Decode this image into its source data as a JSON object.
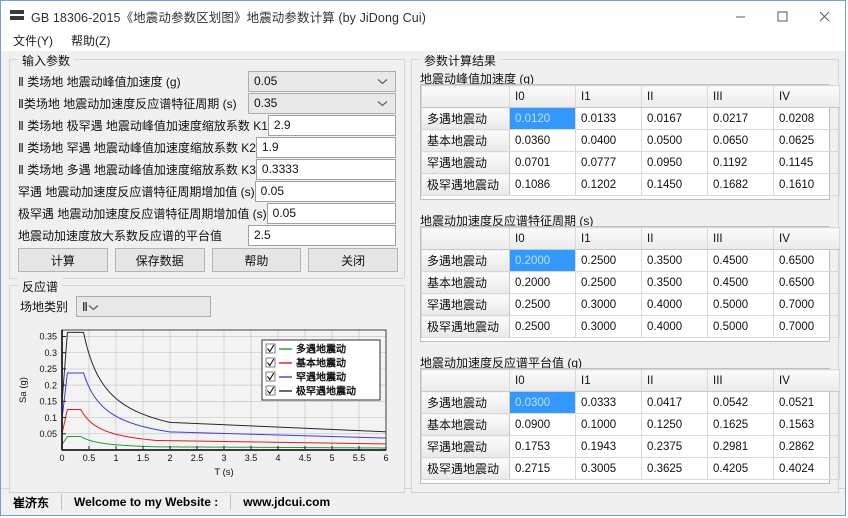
{
  "window": {
    "title": "GB 18306-2015《地震动参数区划图》地震动参数计算 (by JiDong Cui)",
    "icon": "app-icon",
    "minimize": "minimize-icon",
    "maximize": "maximize-icon",
    "close": "close-icon"
  },
  "menu": {
    "items": [
      {
        "label": "文件(Y)"
      },
      {
        "label": "帮助(Z)"
      }
    ]
  },
  "input_group": {
    "title": "输入参数",
    "rows": [
      {
        "label": "Ⅱ 类场地 地震动峰值加速度 (g)",
        "value": "0.05",
        "type": "combo"
      },
      {
        "label": "Ⅱ类场地 地震动加速度反应谱特征周期 (s)",
        "value": "0.35",
        "type": "combo"
      },
      {
        "label": "Ⅱ 类场地 极罕遇 地震动峰值加速度缩放系数 K1",
        "value": "2.9",
        "type": "text"
      },
      {
        "label": "Ⅱ 类场地 罕遇 地震动峰值加速度缩放系数 K2",
        "value": "1.9",
        "type": "text"
      },
      {
        "label": "Ⅱ 类场地 多遇 地震动峰值加速度缩放系数 K3",
        "value": "0.3333",
        "type": "text"
      },
      {
        "label": "罕遇 地震动加速度反应谱特征周期增加值 (s)",
        "value": "0.05",
        "type": "text"
      },
      {
        "label": "极罕遇 地震动加速度反应谱特征周期增加值 (s)",
        "value": "0.05",
        "type": "text"
      },
      {
        "label": "地震动加速度放大系数反应谱的平台值",
        "value": "2.5",
        "type": "text"
      }
    ],
    "buttons": [
      {
        "label": "计算"
      },
      {
        "label": "保存数据"
      },
      {
        "label": "帮助"
      },
      {
        "label": "关闭"
      }
    ]
  },
  "spectrum_group": {
    "title": "反应谱",
    "site_label": "场地类别",
    "site_value": "Ⅱ"
  },
  "result_group": {
    "title": "参数计算结果",
    "tables": [
      {
        "caption": "地震动峰值加速度 (g)",
        "columns": [
          "",
          "I0",
          "I1",
          "II",
          "III",
          "IV"
        ],
        "rows": [
          {
            "label": "多遇地震动",
            "values": [
              "0.0120",
              "0.0133",
              "0.0167",
              "0.0217",
              "0.0208"
            ],
            "selected": 0
          },
          {
            "label": "基本地震动",
            "values": [
              "0.0360",
              "0.0400",
              "0.0500",
              "0.0650",
              "0.0625"
            ]
          },
          {
            "label": "罕遇地震动",
            "values": [
              "0.0701",
              "0.0777",
              "0.0950",
              "0.1192",
              "0.1145"
            ]
          },
          {
            "label": "极罕遇地震动",
            "values": [
              "0.1086",
              "0.1202",
              "0.1450",
              "0.1682",
              "0.1610"
            ]
          }
        ]
      },
      {
        "caption": "地震动加速度反应谱特征周期 (s)",
        "columns": [
          "",
          "I0",
          "I1",
          "II",
          "III",
          "IV"
        ],
        "rows": [
          {
            "label": "多遇地震动",
            "values": [
              "0.2000",
              "0.2500",
              "0.3500",
              "0.4500",
              "0.6500"
            ],
            "selected": 0
          },
          {
            "label": "基本地震动",
            "values": [
              "0.2000",
              "0.2500",
              "0.3500",
              "0.4500",
              "0.6500"
            ]
          },
          {
            "label": "罕遇地震动",
            "values": [
              "0.2500",
              "0.3000",
              "0.4000",
              "0.5000",
              "0.7000"
            ]
          },
          {
            "label": "极罕遇地震动",
            "values": [
              "0.2500",
              "0.3000",
              "0.4000",
              "0.5000",
              "0.7000"
            ]
          }
        ]
      },
      {
        "caption": "地震动加速度反应谱平台值 (g)",
        "columns": [
          "",
          "I0",
          "I1",
          "II",
          "III",
          "IV"
        ],
        "rows": [
          {
            "label": "多遇地震动",
            "values": [
              "0.0300",
              "0.0333",
              "0.0417",
              "0.0542",
              "0.0521"
            ],
            "selected": 0
          },
          {
            "label": "基本地震动",
            "values": [
              "0.0900",
              "0.1000",
              "0.1250",
              "0.1625",
              "0.1563"
            ]
          },
          {
            "label": "罕遇地震动",
            "values": [
              "0.1753",
              "0.1943",
              "0.2375",
              "0.2981",
              "0.2862"
            ]
          },
          {
            "label": "极罕遇地震动",
            "values": [
              "0.2715",
              "0.3005",
              "0.3625",
              "0.4205",
              "0.4024"
            ]
          }
        ]
      }
    ]
  },
  "statusbar": {
    "author": "崔济东",
    "welcome": "Welcome to my Website :",
    "website": "www.jdcui.com"
  },
  "chart_data": {
    "type": "line",
    "title": "",
    "xlabel": "T (s)",
    "ylabel": "Sa (g)",
    "xlim": [
      0,
      6
    ],
    "ylim": [
      0,
      0.37
    ],
    "xticks": [
      0,
      0.5,
      1,
      1.5,
      2,
      2.5,
      3,
      3.5,
      4,
      4.5,
      5,
      5.5,
      6
    ],
    "xtick_labels": [
      "0",
      "0.5",
      "1",
      "1.5",
      "2",
      "2.5",
      "3",
      "3.5",
      "4",
      "4.5",
      "5",
      "5.5",
      "6"
    ],
    "yticks": [
      0.05,
      0.1,
      0.15,
      0.2,
      0.25,
      0.3,
      0.35
    ],
    "ytick_labels": [
      "0.05",
      "0.1",
      "0.15",
      "0.2",
      "0.25",
      "0.3",
      "0.35"
    ],
    "grid": true,
    "legend_position": "upper-right",
    "series": [
      {
        "name": "多遇地震动",
        "color": "#1f9e34",
        "checked": true,
        "plateau": 0.0417,
        "Tg": 0.35,
        "T0": 0.1,
        "a0": 0.0167,
        "points": [
          [
            0.0,
            0.0167
          ],
          [
            0.02,
            0.0217
          ],
          [
            0.05,
            0.0292
          ],
          [
            0.1,
            0.0417
          ],
          [
            0.2,
            0.0417
          ],
          [
            0.35,
            0.0417
          ],
          [
            0.5,
            0.0334
          ],
          [
            0.75,
            0.0253
          ],
          [
            1.0,
            0.0204
          ],
          [
            1.5,
            0.015
          ],
          [
            2.0,
            0.012
          ],
          [
            2.5,
            0.0101
          ],
          [
            3.0,
            0.008
          ],
          [
            3.5,
            0.0062
          ],
          [
            4.0,
            0.0045
          ],
          [
            4.5,
            0.0028
          ],
          [
            5.0,
            0.0012
          ],
          [
            5.5,
            0.0005
          ],
          [
            6.0,
            0.0002
          ]
        ]
      },
      {
        "name": "基本地震动",
        "color": "#e01b1b",
        "checked": true,
        "plateau": 0.125,
        "Tg": 0.35,
        "T0": 0.1,
        "a0": 0.05,
        "points": [
          [
            0.0,
            0.05
          ],
          [
            0.02,
            0.065
          ],
          [
            0.05,
            0.0875
          ],
          [
            0.1,
            0.125
          ],
          [
            0.2,
            0.125
          ],
          [
            0.35,
            0.125
          ],
          [
            0.5,
            0.1001
          ],
          [
            0.75,
            0.0759
          ],
          [
            1.0,
            0.0612
          ],
          [
            1.5,
            0.045
          ],
          [
            2.0,
            0.0358
          ],
          [
            2.5,
            0.03
          ],
          [
            3.0,
            0.0256
          ],
          [
            3.5,
            0.0216
          ],
          [
            4.0,
            0.018
          ],
          [
            4.5,
            0.0148
          ],
          [
            5.0,
            0.0119
          ],
          [
            5.5,
            0.0104
          ],
          [
            6.0,
            0.0093
          ]
        ]
      },
      {
        "name": "罕遇地震动",
        "color": "#3b3bef",
        "checked": true,
        "plateau": 0.2375,
        "Tg": 0.4,
        "T0": 0.1,
        "a0": 0.095,
        "points": [
          [
            0.0,
            0.095
          ],
          [
            0.02,
            0.1235
          ],
          [
            0.05,
            0.1663
          ],
          [
            0.1,
            0.2375
          ],
          [
            0.2,
            0.2375
          ],
          [
            0.4,
            0.2375
          ],
          [
            0.5,
            0.209
          ],
          [
            0.75,
            0.1552
          ],
          [
            1.0,
            0.1249
          ],
          [
            1.5,
            0.0914
          ],
          [
            2.0,
            0.0727
          ],
          [
            2.5,
            0.0607
          ],
          [
            3.0,
            0.052
          ],
          [
            3.5,
            0.0454
          ],
          [
            4.0,
            0.04
          ],
          [
            4.5,
            0.0352
          ],
          [
            5.0,
            0.0309
          ],
          [
            5.5,
            0.0272
          ],
          [
            6.0,
            0.0241
          ]
        ]
      },
      {
        "name": "极罕遇地震动",
        "color": "#2a2a2a",
        "checked": true,
        "plateau": 0.3625,
        "Tg": 0.4,
        "T0": 0.1,
        "a0": 0.145,
        "points": [
          [
            0.0,
            0.145
          ],
          [
            0.02,
            0.1885
          ],
          [
            0.05,
            0.2538
          ],
          [
            0.1,
            0.3625
          ],
          [
            0.2,
            0.3625
          ],
          [
            0.4,
            0.3625
          ],
          [
            0.5,
            0.319
          ],
          [
            0.75,
            0.2369
          ],
          [
            1.0,
            0.1906
          ],
          [
            1.5,
            0.1396
          ],
          [
            2.0,
            0.111
          ],
          [
            2.5,
            0.0927
          ],
          [
            3.0,
            0.0794
          ],
          [
            3.5,
            0.0694
          ],
          [
            4.0,
            0.0612
          ],
          [
            4.5,
            0.054
          ],
          [
            5.0,
            0.0476
          ],
          [
            5.5,
            0.042
          ],
          [
            6.0,
            0.0372
          ]
        ]
      }
    ]
  }
}
